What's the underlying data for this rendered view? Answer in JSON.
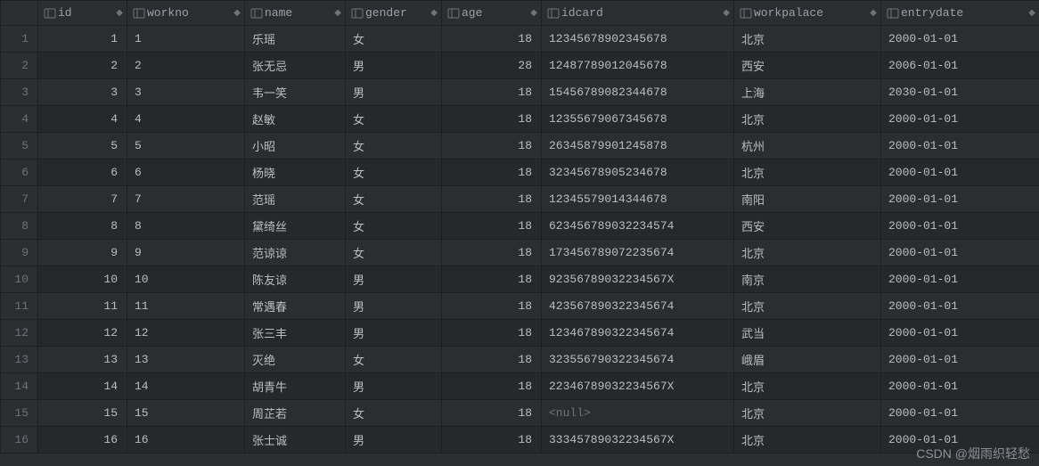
{
  "columns": [
    {
      "key": "id",
      "label": "id",
      "numeric": true
    },
    {
      "key": "workno",
      "label": "workno",
      "numeric": false
    },
    {
      "key": "name",
      "label": "name",
      "numeric": false
    },
    {
      "key": "gender",
      "label": "gender",
      "numeric": false
    },
    {
      "key": "age",
      "label": "age",
      "numeric": true
    },
    {
      "key": "idcard",
      "label": "idcard",
      "numeric": false
    },
    {
      "key": "workpalace",
      "label": "workpalace",
      "numeric": false
    },
    {
      "key": "entrydate",
      "label": "entrydate",
      "numeric": false
    }
  ],
  "rows": [
    {
      "n": "1",
      "id": "1",
      "workno": "1",
      "name": "乐瑶",
      "gender": "女",
      "age": "18",
      "idcard": "12345678902345678",
      "workpalace": "北京",
      "entrydate": "2000-01-01"
    },
    {
      "n": "2",
      "id": "2",
      "workno": "2",
      "name": "张无忌",
      "gender": "男",
      "age": "28",
      "idcard": "12487789012045678",
      "workpalace": "西安",
      "entrydate": "2006-01-01"
    },
    {
      "n": "3",
      "id": "3",
      "workno": "3",
      "name": "韦一笑",
      "gender": "男",
      "age": "18",
      "idcard": "15456789082344678",
      "workpalace": "上海",
      "entrydate": "2030-01-01"
    },
    {
      "n": "4",
      "id": "4",
      "workno": "4",
      "name": "赵敏",
      "gender": "女",
      "age": "18",
      "idcard": "12355679067345678",
      "workpalace": "北京",
      "entrydate": "2000-01-01"
    },
    {
      "n": "5",
      "id": "5",
      "workno": "5",
      "name": "小昭",
      "gender": "女",
      "age": "18",
      "idcard": "26345879901245878",
      "workpalace": "杭州",
      "entrydate": "2000-01-01"
    },
    {
      "n": "6",
      "id": "6",
      "workno": "6",
      "name": "杨晓",
      "gender": "女",
      "age": "18",
      "idcard": "32345678905234678",
      "workpalace": "北京",
      "entrydate": "2000-01-01"
    },
    {
      "n": "7",
      "id": "7",
      "workno": "7",
      "name": "范瑶",
      "gender": "女",
      "age": "18",
      "idcard": "12345579014344678",
      "workpalace": "南阳",
      "entrydate": "2000-01-01"
    },
    {
      "n": "8",
      "id": "8",
      "workno": "8",
      "name": "黛绮丝",
      "gender": "女",
      "age": "18",
      "idcard": "623456789032234574",
      "workpalace": "西安",
      "entrydate": "2000-01-01"
    },
    {
      "n": "9",
      "id": "9",
      "workno": "9",
      "name": "范谅谅",
      "gender": "女",
      "age": "18",
      "idcard": "173456789072235674",
      "workpalace": "北京",
      "entrydate": "2000-01-01"
    },
    {
      "n": "10",
      "id": "10",
      "workno": "10",
      "name": "陈友谅",
      "gender": "男",
      "age": "18",
      "idcard": "92356789032234567X",
      "workpalace": "南京",
      "entrydate": "2000-01-01"
    },
    {
      "n": "11",
      "id": "11",
      "workno": "11",
      "name": "常遇春",
      "gender": "男",
      "age": "18",
      "idcard": "423567890322345674",
      "workpalace": "北京",
      "entrydate": "2000-01-01"
    },
    {
      "n": "12",
      "id": "12",
      "workno": "12",
      "name": "张三丰",
      "gender": "男",
      "age": "18",
      "idcard": "123467890322345674",
      "workpalace": "武当",
      "entrydate": "2000-01-01"
    },
    {
      "n": "13",
      "id": "13",
      "workno": "13",
      "name": "灭绝",
      "gender": "女",
      "age": "18",
      "idcard": "323556790322345674",
      "workpalace": "峨眉",
      "entrydate": "2000-01-01"
    },
    {
      "n": "14",
      "id": "14",
      "workno": "14",
      "name": "胡青牛",
      "gender": "男",
      "age": "18",
      "idcard": "22346789032234567X",
      "workpalace": "北京",
      "entrydate": "2000-01-01"
    },
    {
      "n": "15",
      "id": "15",
      "workno": "15",
      "name": "周芷若",
      "gender": "女",
      "age": "18",
      "idcard": null,
      "workpalace": "北京",
      "entrydate": "2000-01-01"
    },
    {
      "n": "16",
      "id": "16",
      "workno": "16",
      "name": "张士诚",
      "gender": "男",
      "age": "18",
      "idcard": "33345789032234567X",
      "workpalace": "北京",
      "entrydate": "2000-01-01"
    }
  ],
  "null_label": "<null>",
  "watermark": "CSDN @烟雨织轻愁"
}
